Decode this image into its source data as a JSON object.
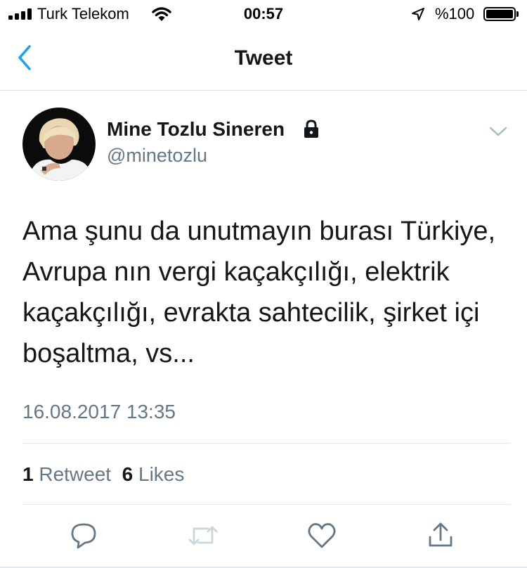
{
  "status_bar": {
    "carrier": "Turk Telekom",
    "time": "00:57",
    "battery": "%100",
    "battery_level": 1.0
  },
  "nav": {
    "title": "Tweet"
  },
  "tweet": {
    "author_name": "Mine Tozlu Sineren",
    "handle": "@minetozlu",
    "protected": true,
    "text": "Ama şunu da unutmayın burası Türkiye, Avrupa nın vergi kaçakçılığı, elektrik kaçakçılığı, evrakta sahtecilik, şirket içi boşaltma, vs...",
    "timestamp": "16.08.2017 13:35",
    "retweet_count": "1",
    "retweet_label": "Retweet",
    "like_count": "6",
    "like_label": "Likes"
  },
  "colors": {
    "accent": "#1da1f2",
    "secondary_text": "#657786",
    "divider": "#e1e8ed"
  },
  "icons": [
    "signal-icon",
    "wifi-icon",
    "location-arrow-icon",
    "battery-icon",
    "back-chevron-icon",
    "lock-icon",
    "chevron-down-icon",
    "reply-icon",
    "retweet-icon",
    "like-icon",
    "share-icon"
  ]
}
